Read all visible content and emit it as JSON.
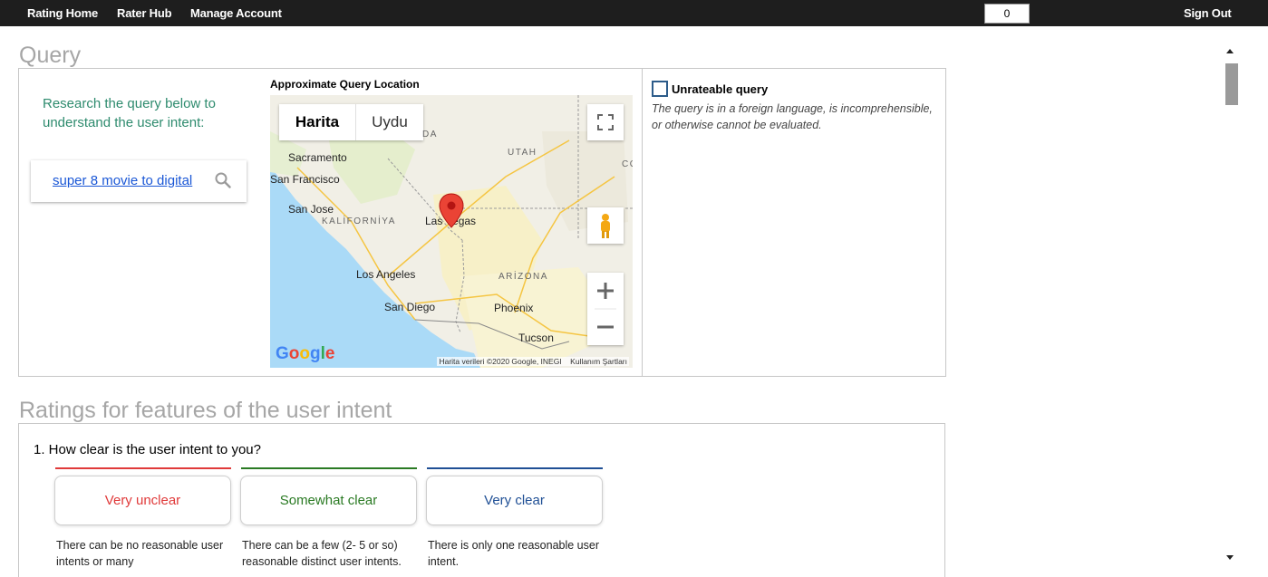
{
  "nav": {
    "rating_home": "Rating Home",
    "rater_hub": "Rater Hub",
    "manage_account": "Manage Account",
    "counter": "0",
    "sign_out": "Sign Out"
  },
  "query_section": {
    "title": "Query",
    "research_text": "Research the query below to understand the user intent:",
    "query_text": "super 8 movie to digital",
    "map_label": "Approximate Query Location",
    "map": {
      "tabs": [
        "Harita",
        "Uydu"
      ],
      "active_tab": "Harita",
      "cities": [
        "Sacramento",
        "San Francisco",
        "San Jose",
        "Las Vegas",
        "Los Angeles",
        "San Diego",
        "Phoenix",
        "Tucson"
      ],
      "regions": [
        "UTAH",
        "KALİFORNİYA",
        "ARİZONA",
        "DA",
        "CO"
      ],
      "attribution": "Harita verileri ©2020 Google, INEGI",
      "terms": "Kullanım Şartları",
      "logo": "Google"
    },
    "unrateable_label": "Unrateable query",
    "unrateable_desc": "The query is in a foreign language, is incomprehensible, or otherwise cannot be evaluated."
  },
  "ratings_section": {
    "title": "Ratings for features of the user intent",
    "question": "1. How clear is the user intent to you?",
    "options": [
      {
        "label": "Very unclear",
        "color": "#e03a3a",
        "desc": "There can be no reasonable user intents or many"
      },
      {
        "label": "Somewhat clear",
        "color": "#2a7a23",
        "desc": "There can be a few (2- 5 or so) reasonable distinct user intents."
      },
      {
        "label": "Very clear",
        "color": "#1f4f95",
        "desc": "There is only one reasonable user intent."
      }
    ]
  }
}
